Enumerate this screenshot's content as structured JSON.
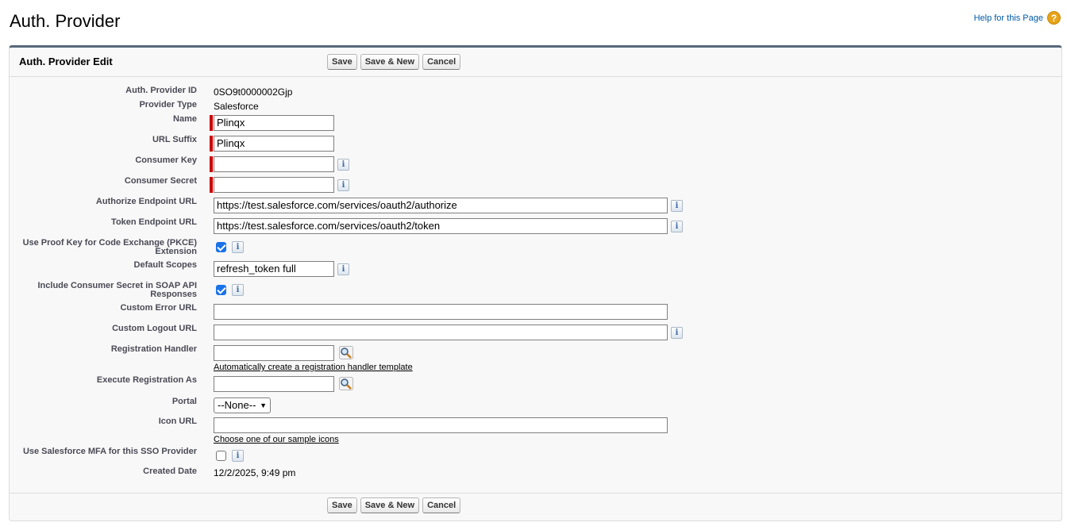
{
  "page": {
    "title": "Auth. Provider",
    "help_link": "Help for this Page",
    "help_icon": "question-icon"
  },
  "panel": {
    "title": "Auth. Provider Edit",
    "buttons": {
      "save": "Save",
      "save_new": "Save & New",
      "cancel": "Cancel"
    }
  },
  "fields": {
    "provider_id": {
      "label": "Auth. Provider ID",
      "value": "0SO9t0000002Gjp"
    },
    "provider_type": {
      "label": "Provider Type",
      "value": "Salesforce"
    },
    "name": {
      "label": "Name",
      "value": "Plinqx"
    },
    "url_suffix": {
      "label": "URL Suffix",
      "value": "Plinqx"
    },
    "consumer_key": {
      "label": "Consumer Key",
      "value": ""
    },
    "consumer_secret": {
      "label": "Consumer Secret",
      "value": ""
    },
    "authorize_url": {
      "label": "Authorize Endpoint URL",
      "value": "https://test.salesforce.com/services/oauth2/authorize"
    },
    "token_url": {
      "label": "Token Endpoint URL",
      "value": "https://test.salesforce.com/services/oauth2/token"
    },
    "pkce": {
      "label_line1": "Use Proof Key for Code Exchange (PKCE)",
      "label_line2": "Extension",
      "checked": true
    },
    "default_scopes": {
      "label": "Default Scopes",
      "value": "refresh_token full"
    },
    "include_secret": {
      "label_line1": "Include Consumer Secret in SOAP API",
      "label_line2": "Responses",
      "checked": true
    },
    "custom_error_url": {
      "label": "Custom Error URL",
      "value": ""
    },
    "custom_logout_url": {
      "label": "Custom Logout URL",
      "value": ""
    },
    "registration_handler": {
      "label": "Registration Handler",
      "value": "",
      "link": "Automatically create a registration handler template"
    },
    "execute_as": {
      "label": "Execute Registration As",
      "value": ""
    },
    "portal": {
      "label": "Portal",
      "value": "--None--"
    },
    "icon_url": {
      "label": "Icon URL",
      "value": "",
      "link": "Choose one of our sample icons"
    },
    "use_mfa": {
      "label": "Use Salesforce MFA for this SSO Provider",
      "checked": false
    },
    "created_date": {
      "label": "Created Date",
      "value": "12/2/2025, 9:49 pm"
    }
  },
  "info_glyph": "i"
}
